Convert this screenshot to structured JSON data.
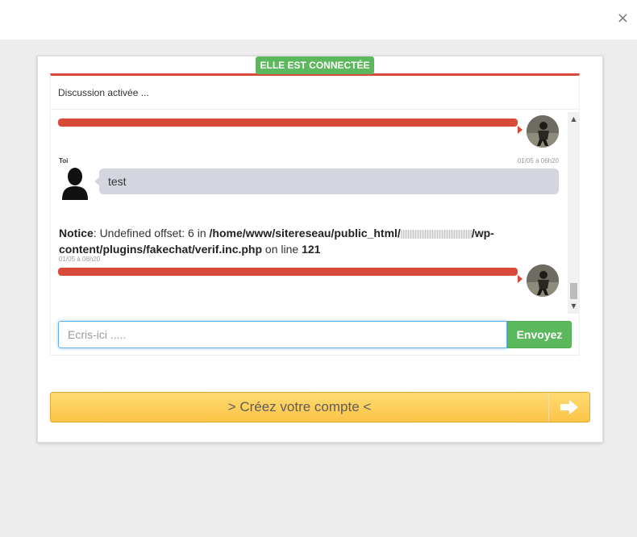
{
  "dialog": {
    "close_icon": "close-icon",
    "close_glyph": "×"
  },
  "chat": {
    "status_badge": "ELLE EST CONNECTÉE",
    "header": "Discussion activée ...",
    "messages": [
      {
        "type": "incoming",
        "text": "",
        "avatar": "profile-photo"
      },
      {
        "type": "self",
        "sender": "Toi",
        "time": "01/05 à 06h20",
        "text": "test",
        "avatar": "silhouette-avatar"
      },
      {
        "type": "notice",
        "label": "Notice",
        "message": ": Undefined offset: 6 in ",
        "path_start": "/home/www/sitereseau/public_html/",
        "path_end": "/wp-content/plugins/fakechat/verif.inc.php",
        "line_text": " on line ",
        "line": "121",
        "time": "01/05 à 06h20"
      },
      {
        "type": "incoming",
        "text": "",
        "avatar": "profile-photo"
      }
    ],
    "input_placeholder": "Ecris-ici .....",
    "input_value": "",
    "send_label": "Envoyez"
  },
  "cta": {
    "label": "> Créez votre compte <",
    "arrow_glyph": "🡆"
  },
  "colors": {
    "accent_red": "#d9493a",
    "online_green": "#5cb85c",
    "cta_yellow": "#fbc447",
    "bubble_gray": "#d3d6df"
  }
}
